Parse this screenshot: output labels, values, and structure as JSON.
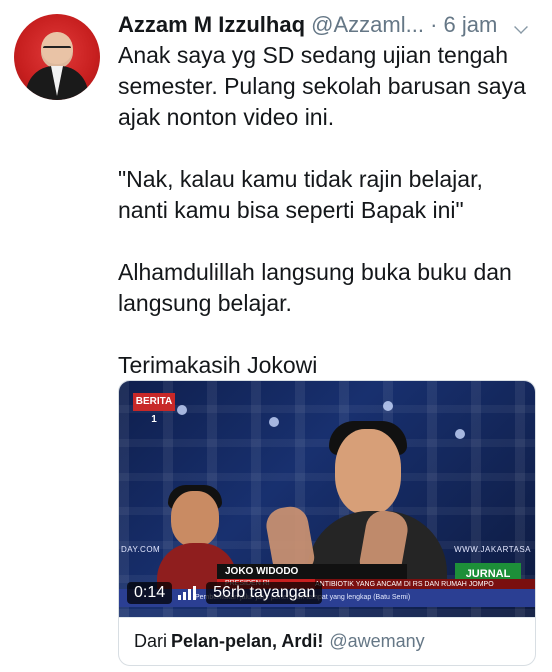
{
  "tweet": {
    "author_name": "Azzam M Izzulhaq",
    "author_handle": "@Azzaml...",
    "separator": "·",
    "time": "6 jam",
    "lines": [
      "Anak saya yg SD sedang ujian tengah semester. Pulang sekolah barusan saya ajak nonton video ini.",
      "\"Nak, kalau kamu tidak rajin belajar, nanti kamu bisa seperti Bapak ini\"",
      "Alhamdulillah langsung buka buku dan langsung belajar.",
      "Terimakasih Jokowi"
    ]
  },
  "media": {
    "channel_badge": "BERITA 1",
    "site_left": "DAY.COM",
    "site_right": "WWW.JAKARTASA",
    "person_name": "JOKO WIDODO",
    "person_title": "PRESIDEN RI",
    "news_logo": "JURNAL",
    "ticker_red": "ANTIBIOTIK YANG ANCAM DI RS DAN RUMAH JOMPO",
    "ticker_blue": "Pembentukan jalur-jalur pertemuan tempat yang lengkap (Batu Semi)",
    "duration": "0:14",
    "views": "56rb tayangan"
  },
  "card_footer": {
    "prefix": "Dari",
    "title": "Pelan-pelan, Ardi!",
    "mention": "@awemany"
  },
  "icons": {
    "chevron": "chevron-down-icon",
    "signal": "signal-bars-icon"
  }
}
